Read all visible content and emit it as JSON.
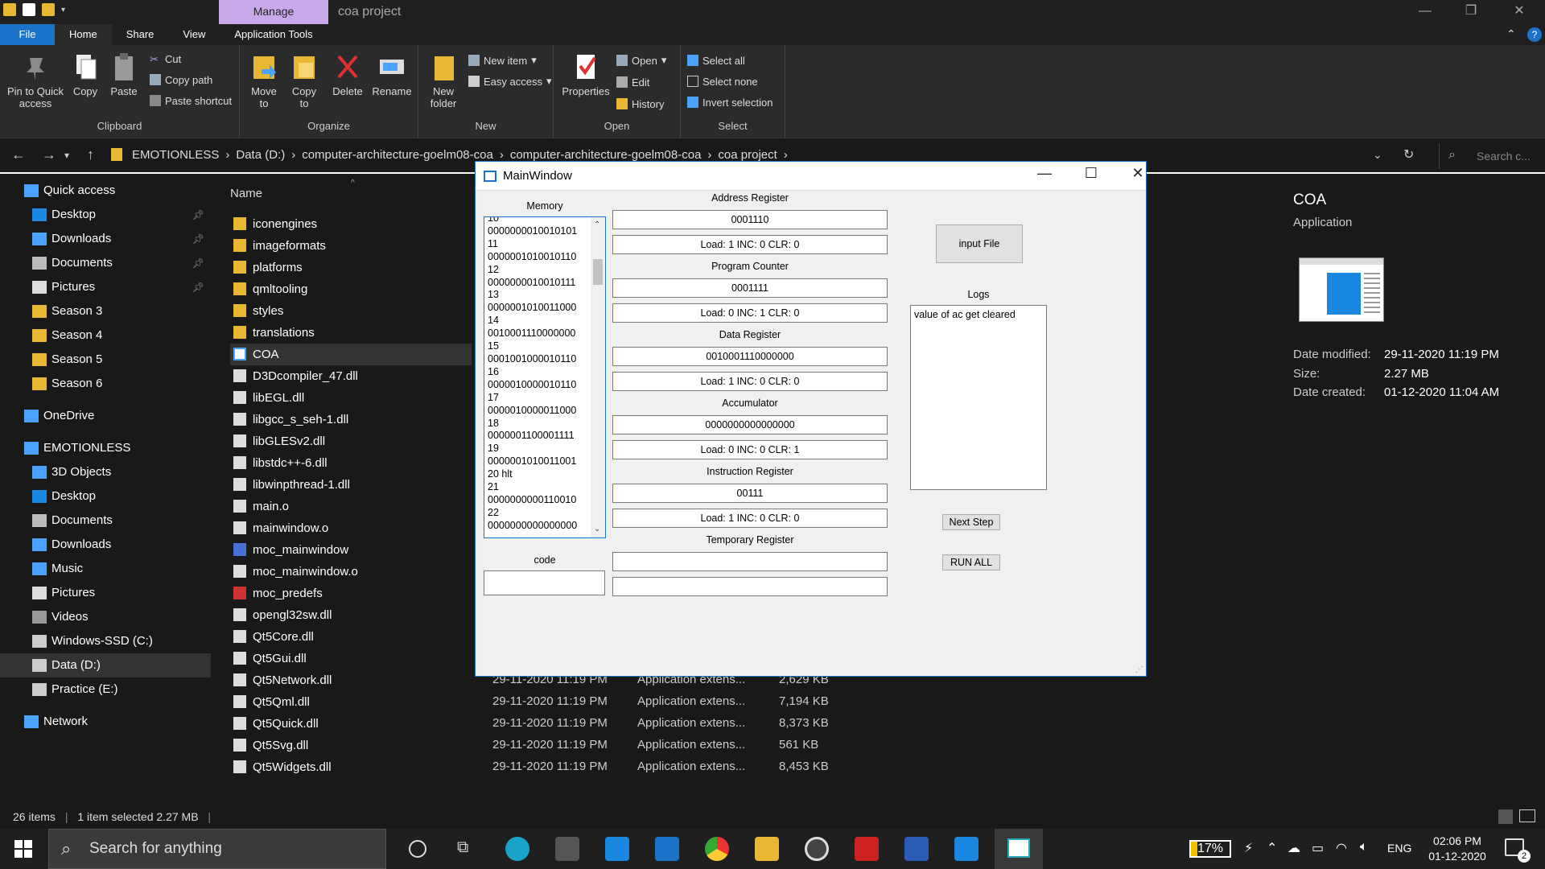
{
  "titlebar": {
    "manage_tab": "Manage",
    "window_title": "coa project"
  },
  "ribbon_tabs": [
    "File",
    "Home",
    "Share",
    "View",
    "Application Tools"
  ],
  "ribbon": {
    "clipboard": {
      "label": "Clipboard",
      "pin": "Pin to Quick access",
      "copy": "Copy",
      "paste": "Paste",
      "cut": "Cut",
      "copy_path": "Copy path",
      "paste_shortcut": "Paste shortcut"
    },
    "organize": {
      "label": "Organize",
      "move_to": "Move to",
      "copy_to": "Copy to",
      "delete": "Delete",
      "rename": "Rename"
    },
    "new": {
      "label": "New",
      "new_folder": "New folder",
      "new_item": "New item",
      "easy_access": "Easy access"
    },
    "open": {
      "label": "Open",
      "properties": "Properties",
      "open": "Open",
      "edit": "Edit",
      "history": "History"
    },
    "select": {
      "label": "Select",
      "select_all": "Select all",
      "select_none": "Select none",
      "invert": "Invert selection"
    }
  },
  "address": {
    "crumbs": [
      "EMOTIONLESS",
      "Data (D:)",
      "computer-architecture-goelm08-coa",
      "computer-architecture-goelm08-coa",
      "coa project"
    ],
    "search_placeholder": "Search c..."
  },
  "nav": [
    {
      "label": "Quick access",
      "icon": "star-icon",
      "pin": false
    },
    {
      "label": "Desktop",
      "icon": "desktop-icon",
      "pin": true
    },
    {
      "label": "Downloads",
      "icon": "download-icon",
      "pin": true
    },
    {
      "label": "Documents",
      "icon": "documents-icon",
      "pin": true
    },
    {
      "label": "Pictures",
      "icon": "pictures-icon",
      "pin": true
    },
    {
      "label": "Season 3",
      "icon": "folder-icon",
      "pin": false
    },
    {
      "label": "Season 4",
      "icon": "folder-icon",
      "pin": false
    },
    {
      "label": "Season 5",
      "icon": "folder-icon",
      "pin": false
    },
    {
      "label": "Season 6",
      "icon": "folder-icon",
      "pin": false
    },
    {
      "label": "OneDrive",
      "icon": "cloud-icon",
      "pin": false
    },
    {
      "label": "EMOTIONLESS",
      "icon": "computer-icon",
      "pin": false
    },
    {
      "label": "3D Objects",
      "icon": "cube-icon",
      "pin": false
    },
    {
      "label": "Desktop",
      "icon": "desktop-icon",
      "pin": false
    },
    {
      "label": "Documents",
      "icon": "documents-icon",
      "pin": false
    },
    {
      "label": "Downloads",
      "icon": "download-icon",
      "pin": false
    },
    {
      "label": "Music",
      "icon": "music-icon",
      "pin": false
    },
    {
      "label": "Pictures",
      "icon": "pictures-icon",
      "pin": false
    },
    {
      "label": "Videos",
      "icon": "video-icon",
      "pin": false
    },
    {
      "label": "Windows-SSD (C:)",
      "icon": "drive-icon",
      "pin": false
    },
    {
      "label": "Data (D:)",
      "icon": "drive-icon",
      "pin": false
    },
    {
      "label": "Practice (E:)",
      "icon": "drive-icon",
      "pin": false
    },
    {
      "label": "Network",
      "icon": "network-icon",
      "pin": false
    }
  ],
  "filelist": {
    "name_header": "Name",
    "files": [
      {
        "name": "iconengines",
        "type": "folder"
      },
      {
        "name": "imageformats",
        "type": "folder"
      },
      {
        "name": "platforms",
        "type": "folder"
      },
      {
        "name": "qmltooling",
        "type": "folder"
      },
      {
        "name": "styles",
        "type": "folder"
      },
      {
        "name": "translations",
        "type": "folder"
      },
      {
        "name": "COA",
        "type": "app"
      },
      {
        "name": "D3Dcompiler_47.dll",
        "type": "file"
      },
      {
        "name": "libEGL.dll",
        "type": "file"
      },
      {
        "name": "libgcc_s_seh-1.dll",
        "type": "file"
      },
      {
        "name": "libGLESv2.dll",
        "type": "file"
      },
      {
        "name": "libstdc++-6.dll",
        "type": "file"
      },
      {
        "name": "libwinpthread-1.dll",
        "type": "file"
      },
      {
        "name": "main.o",
        "type": "file"
      },
      {
        "name": "mainwindow.o",
        "type": "file"
      },
      {
        "name": "moc_mainwindow",
        "type": "cpp"
      },
      {
        "name": "moc_mainwindow.o",
        "type": "file"
      },
      {
        "name": "moc_predefs",
        "type": "header"
      },
      {
        "name": "opengl32sw.dll",
        "type": "file"
      },
      {
        "name": "Qt5Core.dll",
        "type": "file"
      },
      {
        "name": "Qt5Gui.dll",
        "type": "file"
      },
      {
        "name": "Qt5Network.dll",
        "type": "file",
        "date": "29-11-2020 11:19 PM",
        "kind": "Application extens...",
        "size": "2,629 KB"
      },
      {
        "name": "Qt5Qml.dll",
        "type": "file",
        "date": "29-11-2020 11:19 PM",
        "kind": "Application extens...",
        "size": "7,194 KB"
      },
      {
        "name": "Qt5Quick.dll",
        "type": "file",
        "date": "29-11-2020 11:19 PM",
        "kind": "Application extens...",
        "size": "8,373 KB"
      },
      {
        "name": "Qt5Svg.dll",
        "type": "file",
        "date": "29-11-2020 11:19 PM",
        "kind": "Application extens...",
        "size": "561 KB"
      },
      {
        "name": "Qt5Widgets.dll",
        "type": "file",
        "date": "29-11-2020 11:19 PM",
        "kind": "Application extens...",
        "size": "8,453 KB"
      }
    ]
  },
  "details": {
    "name": "COA",
    "kind": "Application",
    "modified_label": "Date modified:",
    "modified": "29-11-2020 11:19 PM",
    "size_label": "Size:",
    "size": "2.27 MB",
    "created_label": "Date created:",
    "created": "01-12-2020 11:04 AM"
  },
  "status": {
    "items": "26 items",
    "selected": "1 item selected  2.27 MB"
  },
  "mainwindow": {
    "title": "MainWindow",
    "memory_label": "Memory",
    "memory_lines": [
      "10",
      "0000000010010101",
      "11",
      "0000001010010110",
      "12",
      "0000000010010111",
      "13",
      "0000001010011000",
      "14",
      "0010001110000000",
      "15",
      "0001001000010110",
      "16",
      "0000010000010110",
      "17",
      "0000010000011000",
      "18",
      "0000001100001111",
      "19",
      "0000001010011001",
      "20  hlt",
      "21",
      "0000000000110010",
      "22",
      "0000000000000000"
    ],
    "code_label": "code",
    "registers": [
      {
        "label": "Address Register",
        "value": "0001110",
        "flags": "Load: 1 INC: 0 CLR: 0"
      },
      {
        "label": "Program Counter",
        "value": "0001111",
        "flags": "Load: 0 INC: 1 CLR: 0"
      },
      {
        "label": "Data Register",
        "value": "0010001110000000",
        "flags": "Load: 1 INC: 0 CLR: 0"
      },
      {
        "label": "Accumulator",
        "value": "0000000000000000",
        "flags": "Load: 0 INC: 0 CLR: 1"
      },
      {
        "label": "Instruction Register",
        "value": "00111",
        "flags": "Load: 1 INC: 0 CLR: 0"
      },
      {
        "label": "Temporary Register",
        "value": "",
        "flags": ""
      }
    ],
    "input_file": "input File",
    "logs_label": "Logs",
    "logs_text": "value of ac get cleared",
    "next_step": "Next Step",
    "run_all": "RUN ALL"
  },
  "taskbar": {
    "search": "Search for anything",
    "battery": "17%",
    "lang": "ENG",
    "time": "02:06 PM",
    "date": "01-12-2020",
    "notif": "2"
  },
  "colors": {
    "accent": "#1a73c8",
    "manage": "#c9a9e9",
    "folder": "#e8b835"
  }
}
